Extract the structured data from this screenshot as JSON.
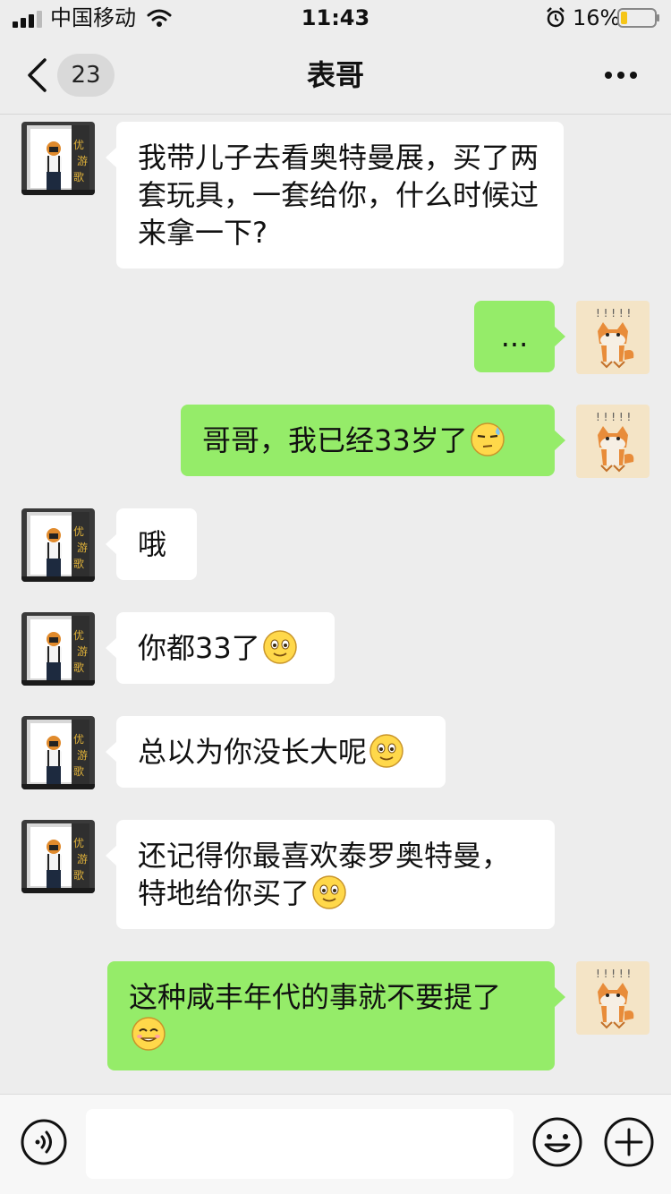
{
  "status_bar": {
    "carrier": "中国移动",
    "time": "11:43",
    "battery": "16%"
  },
  "nav": {
    "unread_count": "23",
    "title": "表哥"
  },
  "messages": [
    {
      "side": "left",
      "text": "我带儿子去看奥特曼展，买了两套玩具，一套给你，什么时候过来拿一下?",
      "emoji": ""
    },
    {
      "side": "right",
      "text": "...",
      "emoji": ""
    },
    {
      "side": "right",
      "text": "哥哥，我已经33岁了",
      "emoji": "sweat-emoji"
    },
    {
      "side": "left",
      "text": "哦",
      "emoji": ""
    },
    {
      "side": "left",
      "text": "你都33了",
      "emoji": "smile-emoji"
    },
    {
      "side": "left",
      "text": "总以为你没长大呢",
      "emoji": "smile-emoji"
    },
    {
      "side": "left",
      "text": "还记得你最喜欢泰罗奥特曼，特地给你买了",
      "emoji": "smile-emoji"
    },
    {
      "side": "right",
      "text": "这种咸丰年代的事就不要提了",
      "emoji": "awkward-smile-emoji"
    }
  ],
  "input": {
    "value": "",
    "placeholder": ""
  },
  "colors": {
    "background": "#ededed",
    "bubble_self": "#95ec69",
    "bubble_other": "#ffffff",
    "battery_low": "#f5c518"
  }
}
